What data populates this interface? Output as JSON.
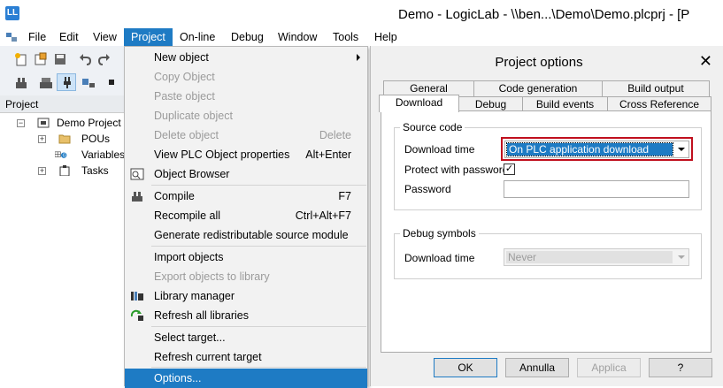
{
  "window": {
    "title": "Demo - LogicLab - \\\\ben...\\Demo\\Demo.plcprj - [P",
    "icon": "logiclab-app-icon"
  },
  "menubar": {
    "items": [
      {
        "label": "File"
      },
      {
        "label": "Edit"
      },
      {
        "label": "View"
      },
      {
        "label": "Project"
      },
      {
        "label": "On-line"
      },
      {
        "label": "Debug"
      },
      {
        "label": "Window"
      },
      {
        "label": "Tools"
      },
      {
        "label": "Help"
      }
    ]
  },
  "left_panel": {
    "header": "Project",
    "tree": [
      {
        "label": "Demo Project",
        "icon": "project-icon"
      },
      {
        "label": "POUs",
        "icon": "folder-icon"
      },
      {
        "label": "Variables",
        "icon": "variables-icon"
      },
      {
        "label": "Tasks",
        "icon": "tasks-icon"
      }
    ]
  },
  "project_menu": {
    "items": [
      {
        "label": "New object",
        "shortcut": ""
      },
      {
        "label": "Copy Object",
        "shortcut": ""
      },
      {
        "label": "Paste object",
        "shortcut": ""
      },
      {
        "label": "Duplicate object",
        "shortcut": ""
      },
      {
        "label": "Delete object",
        "shortcut": "Delete"
      },
      {
        "label": "View PLC Object properties",
        "shortcut": "Alt+Enter"
      },
      {
        "label": "Object Browser",
        "shortcut": ""
      },
      {
        "label": "Compile",
        "shortcut": "F7"
      },
      {
        "label": "Recompile all",
        "shortcut": "Ctrl+Alt+F7"
      },
      {
        "label": "Generate redistributable source module",
        "shortcut": ""
      },
      {
        "label": "Import objects",
        "shortcut": ""
      },
      {
        "label": "Export objects to library",
        "shortcut": ""
      },
      {
        "label": "Library manager",
        "shortcut": ""
      },
      {
        "label": "Refresh all libraries",
        "shortcut": ""
      },
      {
        "label": "Select target...",
        "shortcut": ""
      },
      {
        "label": "Refresh current target",
        "shortcut": ""
      },
      {
        "label": "Options...",
        "shortcut": ""
      }
    ]
  },
  "dialog": {
    "title": "Project options",
    "tabs_row1": [
      {
        "label": "General"
      },
      {
        "label": "Code generation"
      },
      {
        "label": "Build output"
      }
    ],
    "tabs_row2": [
      {
        "label": "Download"
      },
      {
        "label": "Debug"
      },
      {
        "label": "Build events"
      },
      {
        "label": "Cross Reference"
      }
    ],
    "source_code": {
      "legend": "Source code",
      "download_time_label": "Download time",
      "download_time_value": "On PLC application download",
      "protect_label": "Protect with password",
      "protect_checked": "✓",
      "password_label": "Password"
    },
    "debug_symbols": {
      "legend": "Debug symbols",
      "download_time_label": "Download time",
      "download_time_value": "Never"
    },
    "buttons": {
      "ok": "OK",
      "cancel": "Annulla",
      "apply": "Applica",
      "help": "?"
    }
  },
  "colors": {
    "accent": "#1e7bc4",
    "highlight_border": "#c0101e"
  }
}
